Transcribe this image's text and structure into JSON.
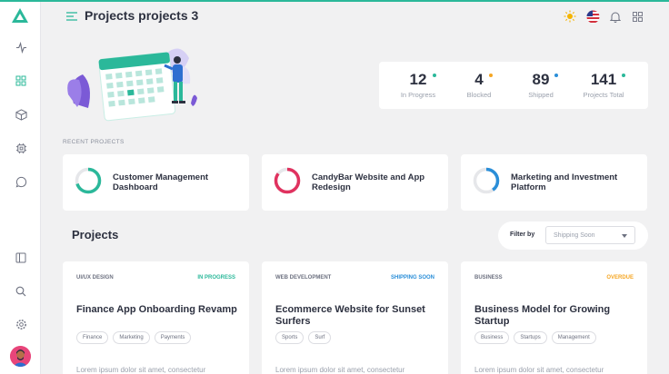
{
  "header": {
    "title": "Projects projects 3"
  },
  "icons": {
    "logo": "logo-triangle-icon",
    "activity": "activity-icon",
    "grid": "grid-icon",
    "box": "box-icon",
    "chip": "chip-icon",
    "chat": "chat-icon",
    "sidebar_toggle": "sidebar-panel-icon",
    "search": "search-icon",
    "settings": "gear-icon",
    "menu": "menu-icon",
    "sun": "sun-icon",
    "flag": "us-flag-icon",
    "bell": "bell-icon",
    "apps": "apps-grid-icon"
  },
  "stats": [
    {
      "value": "12",
      "label": "In Progress",
      "dot_color": "#2bb89a"
    },
    {
      "value": "4",
      "label": "Blocked",
      "dot_color": "#f5a623"
    },
    {
      "value": "89",
      "label": "Shipped",
      "dot_color": "#2a8ed8"
    },
    {
      "value": "141",
      "label": "Projects Total",
      "dot_color": "#2bb89a"
    }
  ],
  "recent": {
    "label": "RECENT PROJECTS",
    "items": [
      {
        "title": "Customer Management Dashboard",
        "progress": 0.7,
        "color": "#2bb89a"
      },
      {
        "title": "CandyBar Website and App Redesign",
        "progress": 0.85,
        "color": "#e0325f"
      },
      {
        "title": "Marketing and Investment Platform",
        "progress": 0.4,
        "color": "#2a8ed8"
      }
    ]
  },
  "projects": {
    "title": "Projects",
    "filter_label": "Filter by",
    "filter_placeholder": "Shipping Soon",
    "cards": [
      {
        "category": "UI/UX DESIGN",
        "status": "IN PROGRESS",
        "status_color": "#2bb89a",
        "title": "Finance App Onboarding Revamp",
        "tags": [
          "Finance",
          "Marketing",
          "Payments"
        ],
        "desc": "Lorem ipsum dolor sit amet, consectetur"
      },
      {
        "category": "WEB DEVELOPMENT",
        "status": "SHIPPING SOON",
        "status_color": "#2a8ed8",
        "title": "Ecommerce Website for Sunset Surfers",
        "tags": [
          "Sports",
          "Surf"
        ],
        "desc": "Lorem ipsum dolor sit amet, consectetur"
      },
      {
        "category": "BUSINESS",
        "status": "OVERDUE",
        "status_color": "#f5a623",
        "title": "Business Model for Growing Startup",
        "tags": [
          "Business",
          "Startups",
          "Management"
        ],
        "desc": "Lorem ipsum dolor sit amet, consectetur"
      }
    ]
  }
}
